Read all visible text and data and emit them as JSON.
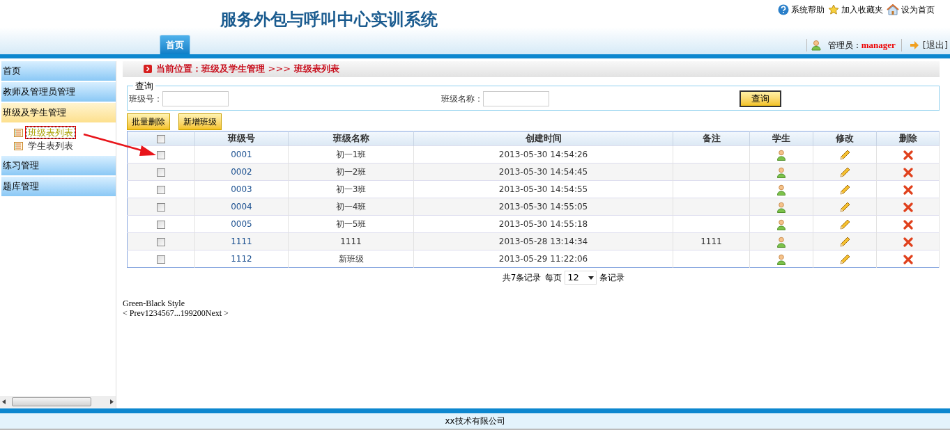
{
  "header": {
    "title": "服务外包与呼叫中心实训系统",
    "links": [
      {
        "label": "系统帮助"
      },
      {
        "label": "加入收藏夹"
      },
      {
        "label": "设为首页"
      }
    ],
    "tabs": [
      {
        "label": "首页",
        "selected": true
      }
    ],
    "user": {
      "label": "管理员：",
      "name": "manager"
    },
    "logout": "[退出]"
  },
  "sidebar": {
    "items": [
      {
        "label": "首页",
        "expanded": false
      },
      {
        "label": "教师及管理员管理",
        "expanded": false
      },
      {
        "label": "班级及学生管理",
        "expanded": true,
        "children": [
          {
            "label": "班级表列表",
            "selected": true
          },
          {
            "label": "学生表列表",
            "selected": false
          }
        ]
      },
      {
        "label": "练习管理",
        "expanded": false
      },
      {
        "label": "题库管理",
        "expanded": false
      }
    ]
  },
  "breadcrumb": {
    "prefix": "当前位置：班级及学生管理",
    "separator": ">>>",
    "current": "班级表列表"
  },
  "query": {
    "legend": "查询",
    "fields": [
      {
        "label": "班级号："
      },
      {
        "label": "班级名称："
      }
    ],
    "button": "查询"
  },
  "actions": [
    "批量删除",
    "新增班级"
  ],
  "table": {
    "select_all": {
      "checked": false
    },
    "columns": [
      "班级号",
      "班级名称",
      "创建时间",
      "备注",
      "学生",
      "修改",
      "删除"
    ],
    "rows": [
      {
        "checked": false,
        "id": "0001",
        "name": "初一1班",
        "created": "2013-05-30 14:54:26"
      },
      {
        "checked": false,
        "id": "0002",
        "name": "初一2班",
        "created": "2013-05-30 14:54:45"
      },
      {
        "checked": false,
        "id": "0003",
        "name": "初一3班",
        "created": "2013-05-30 14:54:55"
      },
      {
        "checked": false,
        "id": "0004",
        "name": "初一4班",
        "created": "2013-05-30 14:55:05"
      },
      {
        "checked": false,
        "id": "0005",
        "name": "初一5班",
        "created": "2013-05-30 14:55:18"
      },
      {
        "checked": false,
        "id": "1111",
        "name": "1111",
        "created": "2013-05-28 13:14:34",
        "note": "1111"
      },
      {
        "checked": false,
        "id": "1112",
        "name": "新班级",
        "created": "2013-05-29 11:22:06"
      }
    ]
  },
  "pagination": {
    "total": "共7条记录",
    "per_page_label": "每页",
    "per_page": "12",
    "suffix": "条记录"
  },
  "style_note": {
    "title": "Green-Black Style",
    "pager": "< Prev1234567...199200Next >"
  },
  "footer": "xx技术有限公司"
}
